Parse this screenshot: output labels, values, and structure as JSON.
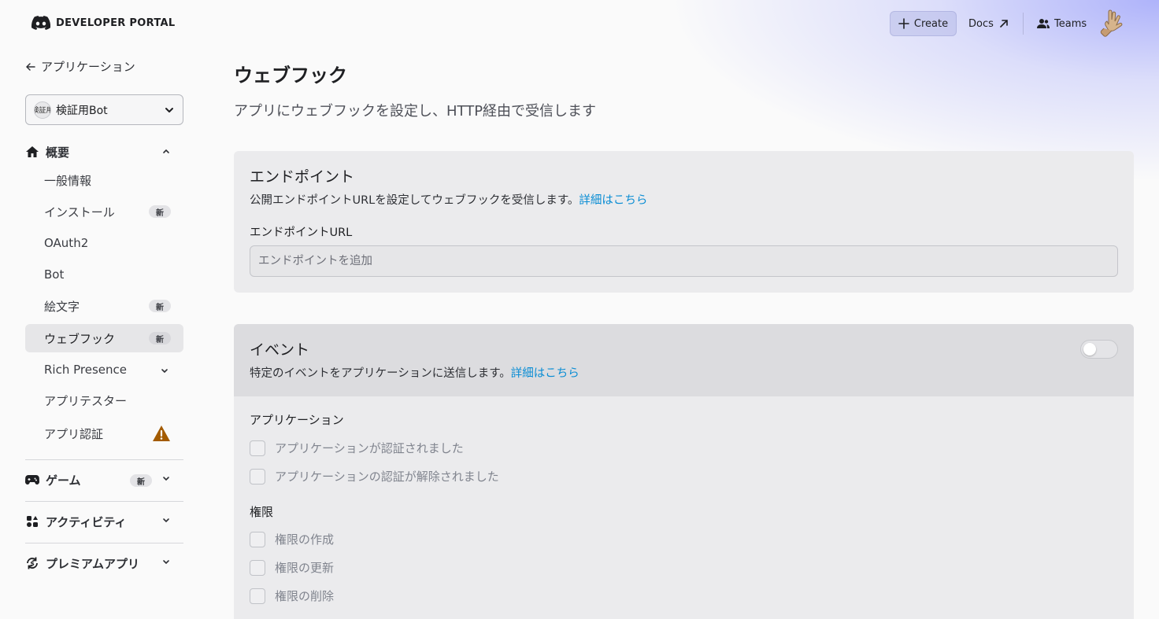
{
  "header": {
    "logo_text": "DEVELOPER PORTAL",
    "create_label": "Create",
    "docs_label": "Docs",
    "teams_label": "Teams"
  },
  "sidebar": {
    "back_label": "アプリケーション",
    "app_select": {
      "icon_text": "検証用",
      "name": "検証用Bot"
    },
    "overview": {
      "label": "概要",
      "items": [
        {
          "label": "一般情報"
        },
        {
          "label": "インストール",
          "badge": "新"
        },
        {
          "label": "OAuth2"
        },
        {
          "label": "Bot"
        },
        {
          "label": "絵文字",
          "badge": "新"
        },
        {
          "label": "ウェブフック",
          "badge": "新",
          "active": true
        },
        {
          "label": "Rich Presence"
        },
        {
          "label": "アプリテスター"
        },
        {
          "label": "アプリ認証"
        }
      ]
    },
    "games": {
      "label": "ゲーム",
      "badge": "新"
    },
    "activities": {
      "label": "アクティビティ"
    },
    "premium": {
      "label": "プレミアムアプリ"
    }
  },
  "main": {
    "title": "ウェブフック",
    "subtitle": "アプリにウェブフックを設定し、HTTP経由で受信します",
    "endpoint_card": {
      "title": "エンドポイント",
      "desc": "公開エンドポイントURLを設定してウェブフックを受信します。",
      "link": "詳細はこちら",
      "field_label": "エンドポイントURL",
      "placeholder": "エンドポイントを追加"
    },
    "events_card": {
      "title": "イベント",
      "desc": "特定のイベントをアプリケーションに送信します。",
      "link": "詳細はこちら",
      "toggle_on": false,
      "groups": [
        {
          "label": "アプリケーション",
          "events": [
            "アプリケーションが認証されました",
            "アプリケーションの認証が解除されました"
          ]
        },
        {
          "label": "権限",
          "events": [
            "権限の作成",
            "権限の更新",
            "権限の削除"
          ]
        }
      ]
    }
  },
  "colors": {
    "link": "#0a8dd4",
    "warning": "#a35b00",
    "accent_glow": "#aaaffa"
  }
}
